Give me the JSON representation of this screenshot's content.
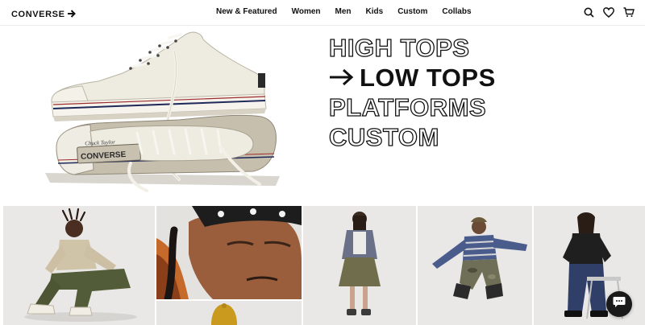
{
  "header": {
    "logo_text": "CONVERSE",
    "nav": [
      "New & Featured",
      "Women",
      "Men",
      "Kids",
      "Custom",
      "Collabs"
    ],
    "icons": [
      "search-icon",
      "heart-icon",
      "cart-icon"
    ]
  },
  "hero": {
    "image": "shoe-stack",
    "categories": [
      {
        "label": "HIGH TOPS",
        "active": false
      },
      {
        "label": "LOW TOPS",
        "active": true
      },
      {
        "label": "PLATFORMS",
        "active": false
      },
      {
        "label": "CUSTOM",
        "active": false
      }
    ],
    "shoe_text": {
      "side_label": "CONVERSE",
      "signature": "Chuck Taylor"
    }
  },
  "gallery": {
    "tiles": [
      "model-sitting",
      "model-bandana-closeup",
      "model-yellow-hat",
      "model-standing-skirt",
      "model-jumping",
      "model-stool"
    ]
  },
  "chat": {
    "icon": "chat-icon"
  },
  "colors": {
    "text": "#111111",
    "canvas": "#ffffff",
    "photo_bg": "#e7e6e4",
    "shoe_canvas": "#eeebe0",
    "stripe_red": "#9c2b2b"
  }
}
